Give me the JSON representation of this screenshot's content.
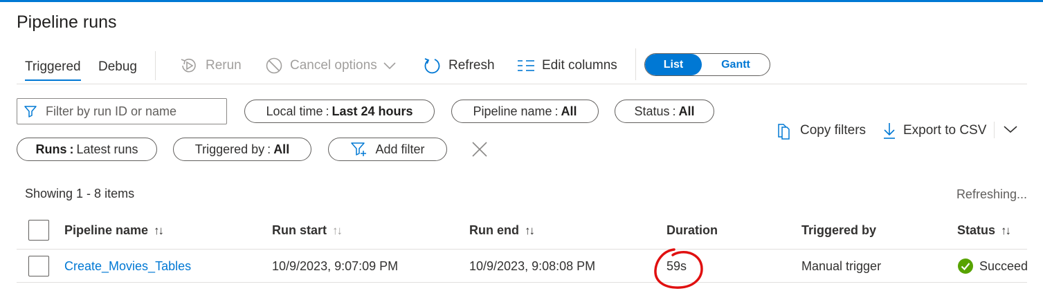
{
  "page": {
    "title": "Pipeline runs"
  },
  "tabs": [
    {
      "label": "Triggered",
      "active": true
    },
    {
      "label": "Debug",
      "active": false
    }
  ],
  "toolbar": {
    "rerun": {
      "label": "Rerun",
      "icon": "rerun-icon",
      "disabled": true
    },
    "cancel": {
      "label": "Cancel options",
      "icon": "cancel-icon",
      "disabled": true
    },
    "refresh": {
      "label": "Refresh",
      "icon": "refresh-icon"
    },
    "edit_columns": {
      "label": "Edit columns",
      "icon": "columns-icon"
    }
  },
  "view_toggle": {
    "list": "List",
    "gantt": "Gantt",
    "selected": "List"
  },
  "filters": {
    "search_placeholder": "Filter by run ID or name",
    "local_time": {
      "label": "Local time",
      "value": "Last 24 hours"
    },
    "pipeline_name": {
      "label": "Pipeline name",
      "value": "All"
    },
    "status": {
      "label": "Status",
      "value": "All"
    },
    "runs": {
      "label": "Runs",
      "value": "Latest runs"
    },
    "triggered_by": {
      "label": "Triggered by",
      "value": "All"
    },
    "add_filter": "Add filter",
    "separator": ":"
  },
  "actions": {
    "copy_filters": "Copy filters",
    "export_csv": "Export to CSV"
  },
  "summary": {
    "showing": "Showing 1 - 8 items",
    "refreshing": "Refreshing..."
  },
  "table": {
    "columns": {
      "pipeline_name": "Pipeline name",
      "run_start": "Run start",
      "run_end": "Run end",
      "duration": "Duration",
      "triggered_by": "Triggered by",
      "status": "Status"
    },
    "rows": [
      {
        "pipeline_name": "Create_Movies_Tables",
        "run_start": "10/9/2023, 9:07:09 PM",
        "run_end": "10/9/2023, 9:08:08 PM",
        "duration": "59s",
        "triggered_by": "Manual trigger",
        "status": "Succeed"
      }
    ]
  },
  "colors": {
    "accent": "#0078d4",
    "success": "#57a300",
    "annotation": "#e01010"
  }
}
